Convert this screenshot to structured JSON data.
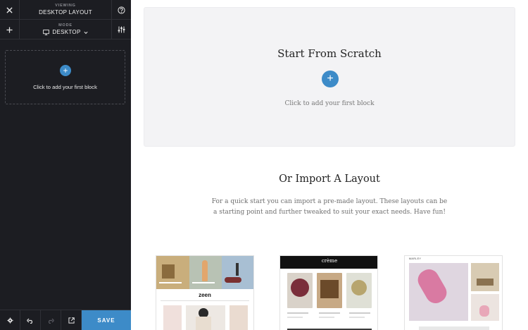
{
  "sidebar": {
    "viewing_label": "VIEWING",
    "viewing_value": "DESKTOP LAYOUT",
    "mode_label": "MODE",
    "mode_value": "DESKTOP",
    "dropzone_text": "Click to add your first block",
    "save_label": "SAVE"
  },
  "main": {
    "scratch_title": "Start From Scratch",
    "scratch_subtitle": "Click to add your first block",
    "import_title": "Or Import A Layout",
    "import_description": "For a quick start you can import a pre-made layout. These layouts can be a starting point and further tweaked to suit your exact needs. Have fun!"
  },
  "layouts": [
    {
      "name": "zeen",
      "logo": "zeen"
    },
    {
      "name": "creme",
      "logo": "crème"
    },
    {
      "name": "marley",
      "logo": "MARLEY"
    }
  ],
  "colors": {
    "accent": "#3d8bc8",
    "sidebar_bg": "#1c1d22",
    "panel_bg": "#f3f3f5"
  }
}
